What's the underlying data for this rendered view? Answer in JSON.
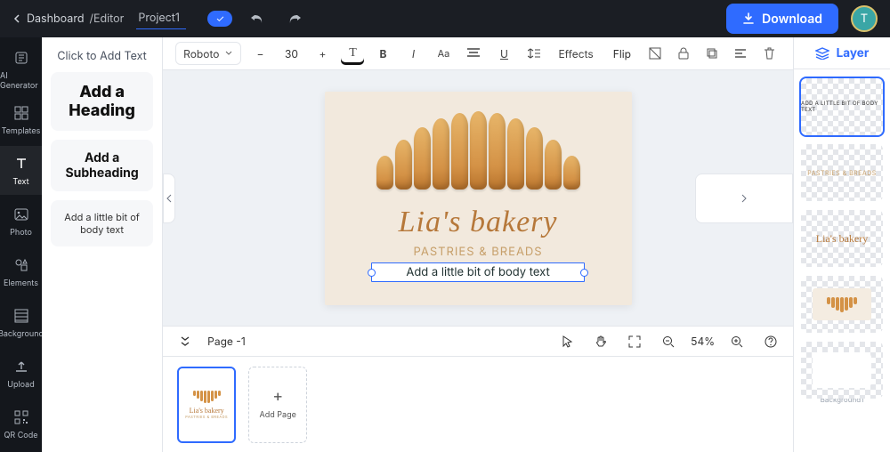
{
  "header": {
    "dashboard_link": "Dashboard",
    "editor_label": "/Editor",
    "project_name": "Project1",
    "download_label": "Download",
    "avatar_initial": "T",
    "cloud_sync": "✓"
  },
  "rail": {
    "items": [
      {
        "key": "ai",
        "label": "AI Generator"
      },
      {
        "key": "templates",
        "label": "Templates"
      },
      {
        "key": "text",
        "label": "Text"
      },
      {
        "key": "photo",
        "label": "Photo"
      },
      {
        "key": "elements",
        "label": "Elements"
      },
      {
        "key": "background",
        "label": "Background"
      },
      {
        "key": "upload",
        "label": "Upload"
      },
      {
        "key": "qrcode",
        "label": "QR Code"
      }
    ],
    "active": "text"
  },
  "side_panel": {
    "heading": "Click to Add Text",
    "add_heading": "Add a Heading",
    "add_subheading": "Add a Subheading",
    "add_body": "Add a little bit of body text"
  },
  "toolbar": {
    "font": "Roboto",
    "size": "30",
    "effects": "Effects",
    "flip": "Flip"
  },
  "canvas": {
    "title": "Lia's bakery",
    "subtitle": "PASTRIES & BREADS",
    "selected_text": "Add a little bit of body text"
  },
  "status": {
    "page_label": "Page -1",
    "zoom": "54%"
  },
  "thumbs": {
    "add_page": "Add Page"
  },
  "layer_panel": {
    "heading": "Layer",
    "layers": [
      {
        "label": "Add a little bit of body text",
        "kind": "text-small",
        "selected": true
      },
      {
        "label": "PASTRIES & BREADS",
        "kind": "text-sub",
        "selected": false
      },
      {
        "label": "Lia's bakery",
        "kind": "text-script",
        "selected": false
      },
      {
        "label": "",
        "kind": "image-bread",
        "selected": false
      },
      {
        "label": "Background1",
        "kind": "background",
        "selected": false
      }
    ]
  }
}
